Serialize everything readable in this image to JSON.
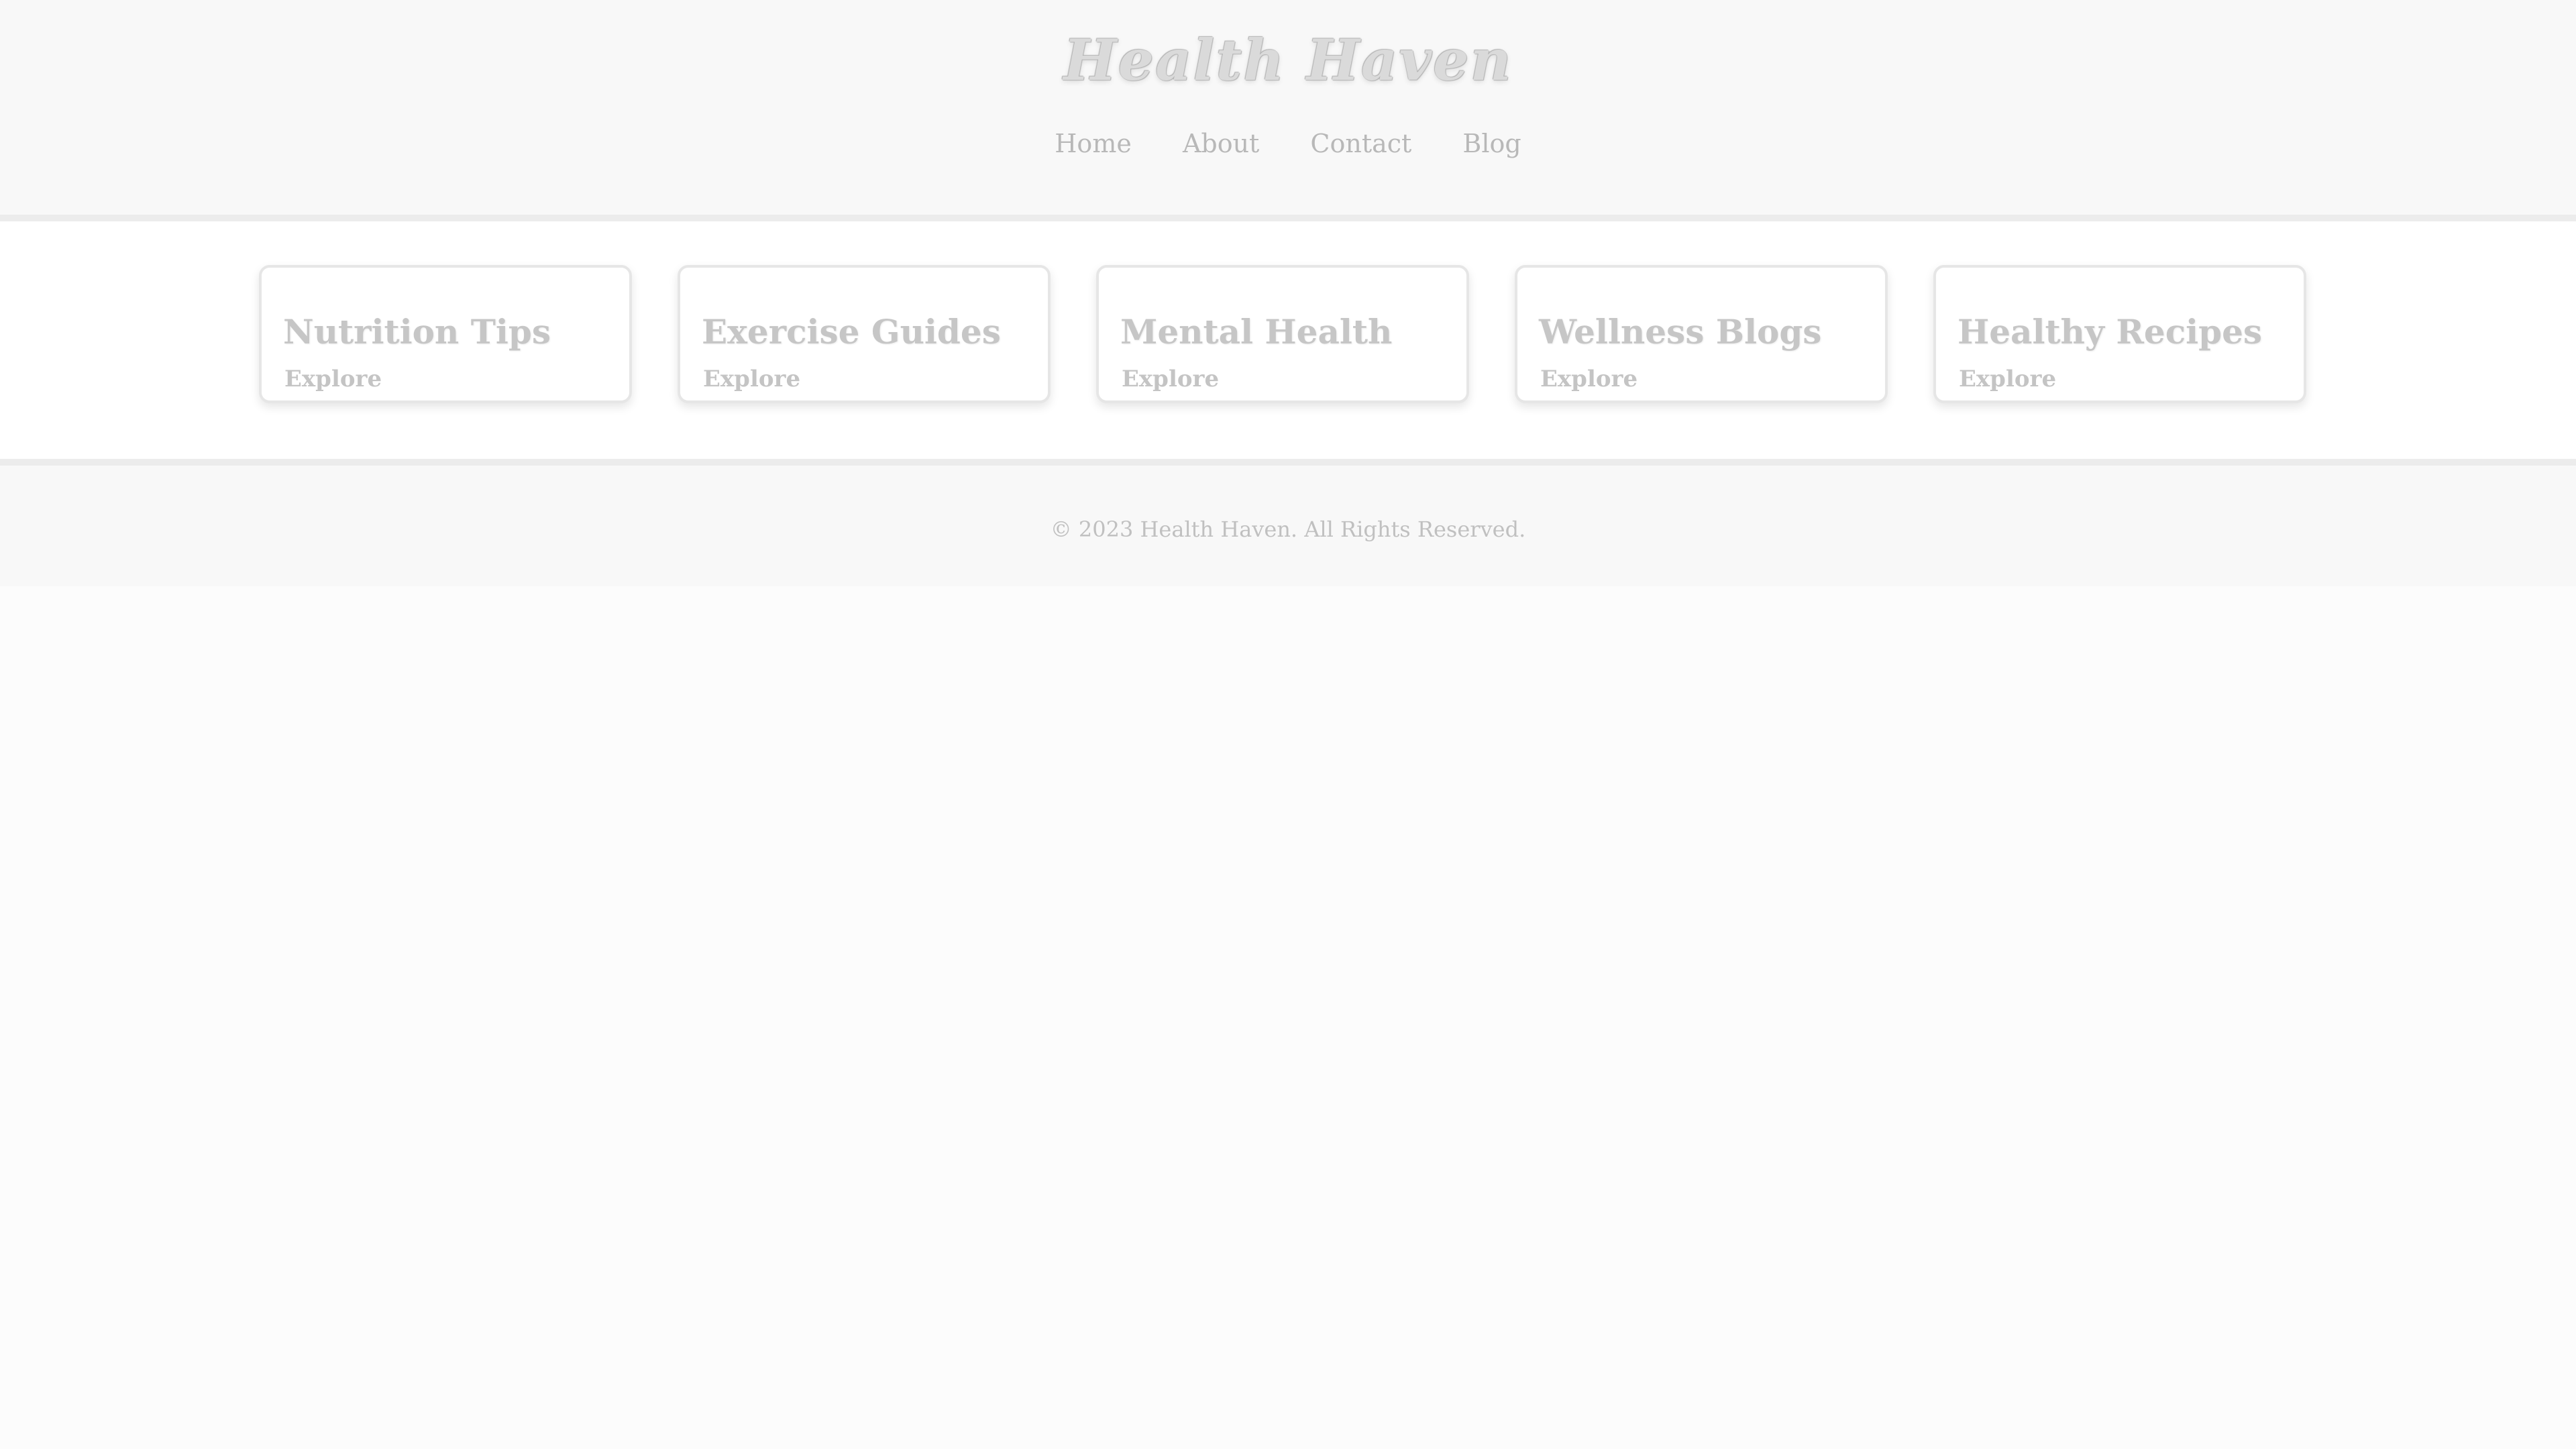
{
  "header": {
    "logo": "Health Haven",
    "nav": [
      {
        "label": "Home"
      },
      {
        "label": "About"
      },
      {
        "label": "Contact"
      },
      {
        "label": "Blog"
      }
    ]
  },
  "cards": [
    {
      "title": "Nutrition Tips",
      "link": "Explore"
    },
    {
      "title": "Exercise Guides",
      "link": "Explore"
    },
    {
      "title": "Mental Health",
      "link": "Explore"
    },
    {
      "title": "Wellness Blogs",
      "link": "Explore"
    },
    {
      "title": "Healthy Recipes",
      "link": "Explore"
    }
  ],
  "footer": {
    "text": "© 2023 Health Haven. All Rights Reserved."
  }
}
